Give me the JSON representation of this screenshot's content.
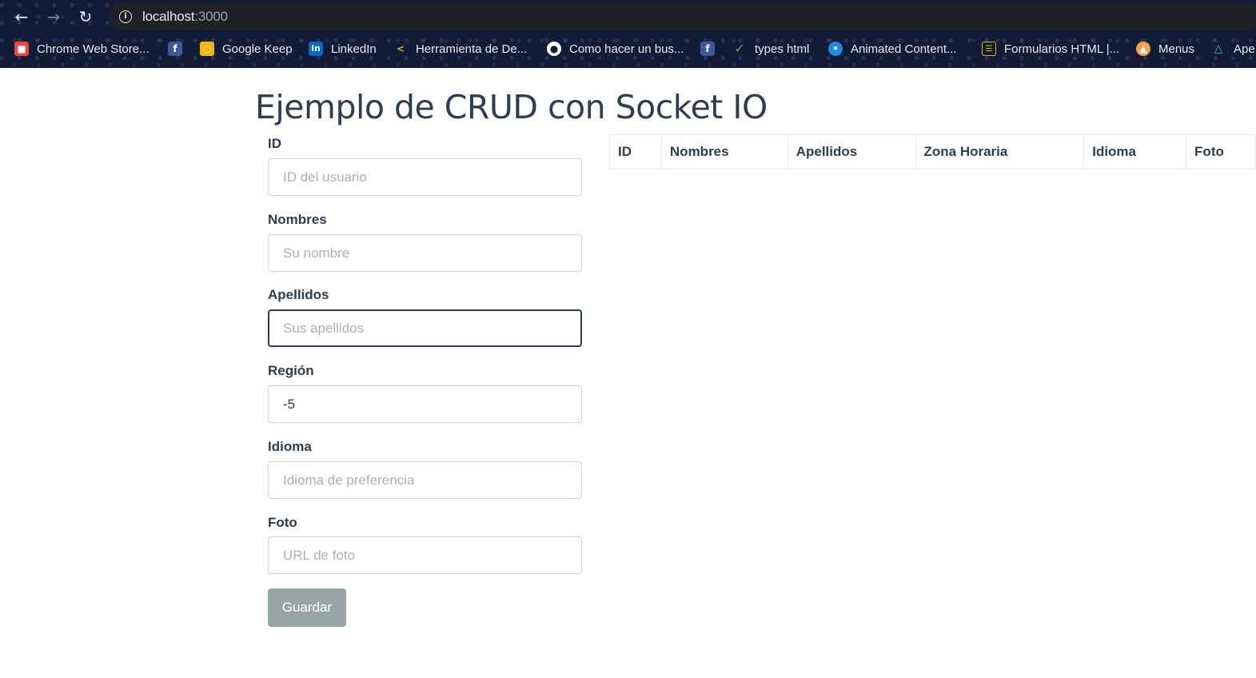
{
  "browser": {
    "nav": {
      "back_icon": "arrow-left-icon",
      "forward_icon": "arrow-right-icon",
      "reload_icon": "reload-icon"
    },
    "address_bar": {
      "host": "localhost",
      "port": ":3000"
    },
    "bookmarks": [
      {
        "label": "Chrome Web Store...",
        "icon": "chrome-web-store-icon"
      },
      {
        "label": "",
        "icon": "facebook-icon"
      },
      {
        "label": "Google Keep",
        "icon": "google-keep-icon"
      },
      {
        "label": "LinkedIn",
        "icon": "linkedin-icon"
      },
      {
        "label": "Herramienta de De...",
        "icon": "code-tool-icon"
      },
      {
        "label": "Como hacer un bus...",
        "icon": "globe-icon"
      },
      {
        "label": "",
        "icon": "facebook-icon"
      },
      {
        "label": "types html",
        "icon": "checkmark-icon"
      },
      {
        "label": "Animated Content...",
        "icon": "drop-icon"
      },
      {
        "label": "Formularios HTML |...",
        "icon": "form-icon"
      },
      {
        "label": "Menus",
        "icon": "menu-site-icon"
      },
      {
        "label": "Ape",
        "icon": "triangle-icon"
      }
    ]
  },
  "page": {
    "title": "Ejemplo de CRUD con Socket IO",
    "form": {
      "fields": [
        {
          "label": "ID",
          "value": "",
          "placeholder": "ID del usuario"
        },
        {
          "label": "Nombres",
          "value": "",
          "placeholder": "Su nombre"
        },
        {
          "label": "Apellidos",
          "value": "",
          "placeholder": "Sus apellidos",
          "focused": true
        },
        {
          "label": "Región",
          "value": "-5",
          "placeholder": ""
        },
        {
          "label": "Idioma",
          "value": "",
          "placeholder": "Idioma de preferencia"
        },
        {
          "label": "Foto",
          "value": "",
          "placeholder": "URL de foto"
        }
      ],
      "submit_label": "Guardar"
    },
    "table": {
      "headers": [
        "ID",
        "Nombres",
        "Apellidos",
        "Zona Horaria",
        "Idioma",
        "Foto"
      ],
      "rows": []
    }
  },
  "colors": {
    "text": "#2c3e50",
    "button": "#95a5a6",
    "input_border": "#ced4da",
    "chrome_bg": "#121c36"
  }
}
